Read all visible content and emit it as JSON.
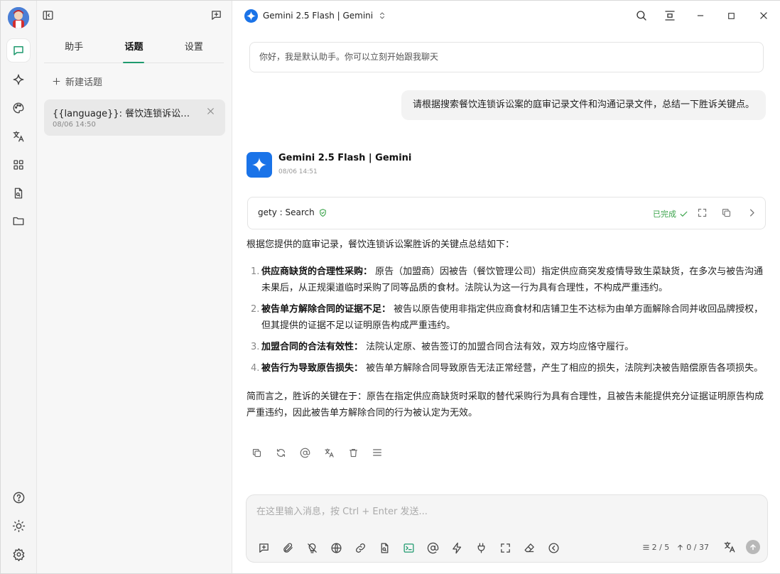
{
  "colors": {
    "accent": "#1f9a6e",
    "done": "#3aa34a",
    "gemini_blue": "#1a73e8"
  },
  "panel": {
    "tabs": [
      {
        "label": "助手",
        "active": false
      },
      {
        "label": "话题",
        "active": true
      },
      {
        "label": "设置",
        "active": false
      }
    ],
    "new_topic_label": "新建话题",
    "topics": [
      {
        "title": "{{language}}: 餐饮连锁诉讼案胜诉关键点",
        "time": "08/06 14:50"
      }
    ]
  },
  "topbar": {
    "model_label": "Gemini 2.5 Flash | Gemini"
  },
  "chat": {
    "greeting": "你好，我是默认助手。你可以立刻开始跟我聊天",
    "user_message": "请根据搜索餐饮连锁诉讼案的庭审记录文件和沟通记录文件，总结一下胜诉关键点。",
    "assistant": {
      "name": "Gemini 2.5 Flash | Gemini",
      "time": "08/06 14:51",
      "tool": {
        "name": "gety : Search",
        "status": "已完成"
      },
      "intro": "根据您提供的庭审记录，餐饮连锁诉讼案胜诉的关键点总结如下：",
      "points": [
        {
          "num": "1.",
          "title": "供应商缺货的合理性采购：",
          "text": "原告（加盟商）因被告（餐饮管理公司）指定供应商突发疫情导致生菜缺货，在多次与被告沟通未果后，从正规渠道临时采购了同等品质的食材。法院认为这一行为具有合理性，不构成严重违约。"
        },
        {
          "num": "2.",
          "title": "被告单方解除合同的证据不足：",
          "text": "被告以原告使用非指定供应商食材和店铺卫生不达标为由单方面解除合同并收回品牌授权，但其提供的证据不足以证明原告构成严重违约。"
        },
        {
          "num": "3.",
          "title": "加盟合同的合法有效性：",
          "text": "法院认定原、被告签订的加盟合同合法有效，双方均应恪守履行。"
        },
        {
          "num": "4.",
          "title": "被告行为导致原告损失：",
          "text": "被告单方解除合同导致原告无法正常经营，产生了相应的损失，法院判决被告赔偿原告各项损失。"
        }
      ],
      "summary": "简而言之，胜诉的关键在于：原告在指定供应商缺货时采取的替代采购行为具有合理性，且被告未能提供充分证据证明原告构成严重违约，因此被告单方解除合同的行为被认定为无效。"
    }
  },
  "input": {
    "placeholder": "在这里输入消息，按 Ctrl + Enter 发送...",
    "context_count": "2 / 5",
    "token_count": "0 / 37"
  }
}
